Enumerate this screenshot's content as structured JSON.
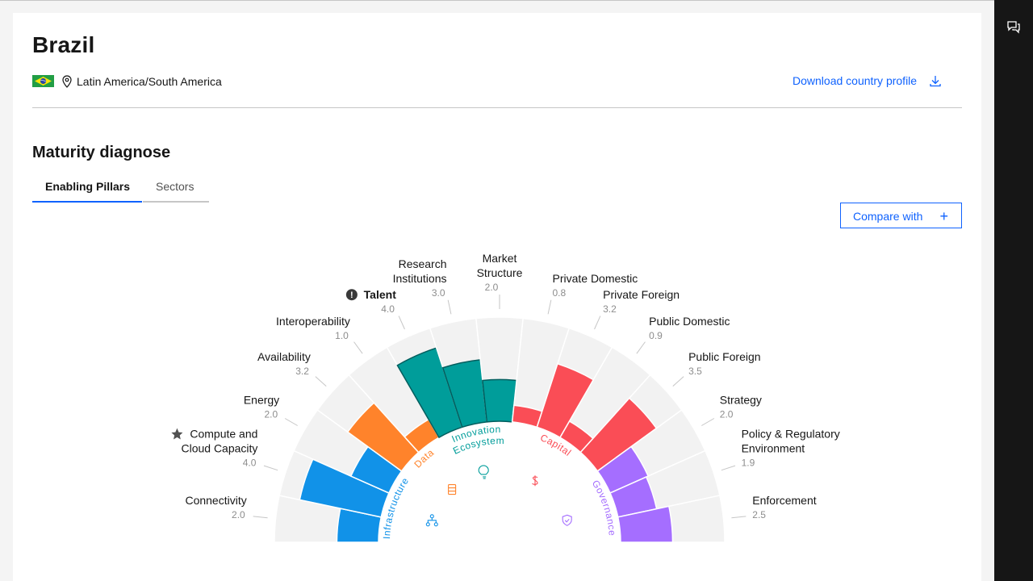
{
  "header": {
    "country": "Brazil",
    "region": "Latin America/South America",
    "download_label": "Download country profile"
  },
  "section": {
    "title": "Maturity diagnose",
    "tabs": [
      {
        "label": "Enabling Pillars",
        "active": true
      },
      {
        "label": "Sectors",
        "active": false
      }
    ],
    "compare_label": "Compare with",
    "compare_icon": "+"
  },
  "colors": {
    "accent": "#0f62fe",
    "Infrastructure": "#1192e8",
    "Data": "#ff832b",
    "Innovation Ecosystem": "#009d9a",
    "Capital": "#fa4d56",
    "Governance": "#a56eff",
    "track": "#f2f2f2"
  },
  "chart_data": {
    "type": "radial-bar",
    "max": 5,
    "pillars": [
      {
        "name": "Infrastructure",
        "icon": "network-icon"
      },
      {
        "name": "Data",
        "icon": "database-icon"
      },
      {
        "name": "Innovation Ecosystem",
        "icon": "lightbulb-icon"
      },
      {
        "name": "Capital",
        "icon": "dollar-icon"
      },
      {
        "name": "Governance",
        "icon": "shield-icon"
      }
    ],
    "indicators": [
      {
        "name": "Connectivity",
        "value": "2.0",
        "pillar": "Infrastructure"
      },
      {
        "name": "Compute and Cloud Capacity",
        "value": "4.0",
        "pillar": "Infrastructure",
        "badge": "star"
      },
      {
        "name": "Energy",
        "value": "2.0",
        "pillar": "Infrastructure"
      },
      {
        "name": "Availability",
        "value": "3.2",
        "pillar": "Data"
      },
      {
        "name": "Interoperability",
        "value": "1.0",
        "pillar": "Data"
      },
      {
        "name": "Talent",
        "value": "4.0",
        "pillar": "Innovation Ecosystem",
        "badge": "alert"
      },
      {
        "name": "Research Institutions",
        "value": "3.0",
        "pillar": "Innovation Ecosystem"
      },
      {
        "name": "Market Structure",
        "value": "2.0",
        "pillar": "Innovation Ecosystem"
      },
      {
        "name": "Private Domestic",
        "value": "0.8",
        "pillar": "Capital"
      },
      {
        "name": "Private Foreign",
        "value": "3.2",
        "pillar": "Capital"
      },
      {
        "name": "Public Domestic",
        "value": "0.9",
        "pillar": "Capital"
      },
      {
        "name": "Public Foreign",
        "value": "3.5",
        "pillar": "Capital"
      },
      {
        "name": "Strategy",
        "value": "2.0",
        "pillar": "Governance"
      },
      {
        "name": "Policy & Regulatory Environment",
        "value": "1.9",
        "pillar": "Governance"
      },
      {
        "name": "Enforcement",
        "value": "2.5",
        "pillar": "Governance"
      }
    ]
  }
}
